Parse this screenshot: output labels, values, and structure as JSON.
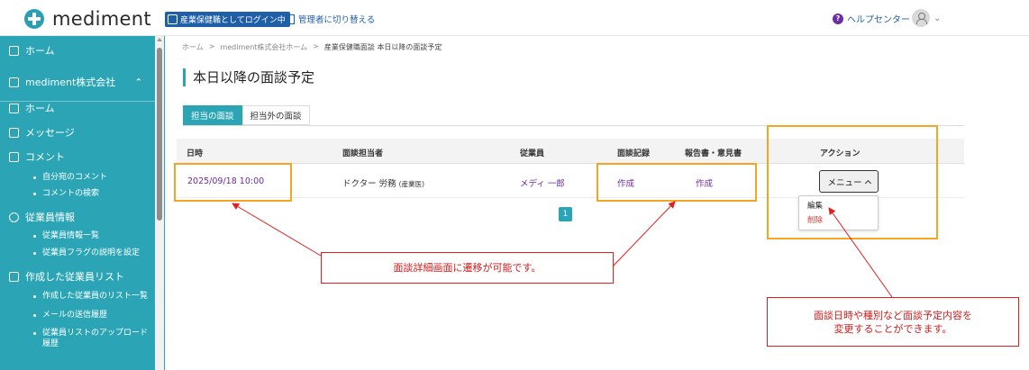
{
  "header": {
    "brand": "mediment",
    "role_badge": "産業保健職としてログイン中",
    "switch_link": "管理者に切り替える",
    "help": "ヘルプセンター"
  },
  "sidebar": {
    "home_top": "ホーム",
    "company": "mediment株式会社",
    "items": [
      {
        "label": "ホーム"
      },
      {
        "label": "メッセージ"
      },
      {
        "label": "コメント"
      },
      {
        "label": "自分宛のコメント"
      },
      {
        "label": "コメントの検索"
      },
      {
        "label": "従業員情報"
      },
      {
        "label": "従業員情報一覧"
      },
      {
        "label": "従業員フラグの説明を設定"
      },
      {
        "label": "作成した従業員リスト"
      },
      {
        "label": "作成した従業員のリスト一覧"
      },
      {
        "label": "メールの送信履歴"
      },
      {
        "label": "従業員リストのアップロード"
      },
      {
        "label": "履歴"
      }
    ]
  },
  "breadcrumb": {
    "items": [
      "ホーム",
      "mediment株式会社ホーム",
      "産業保健職面談 本日以降の面談予定"
    ],
    "separator": ">"
  },
  "page": {
    "title": "本日以降の面談予定",
    "tabs": [
      {
        "label": "担当の面談",
        "active": true
      },
      {
        "label": "担当外の面談",
        "active": false
      }
    ]
  },
  "table": {
    "columns": [
      "日時",
      "面談担当者",
      "従業員",
      "面談記録",
      "報告書・意見書",
      "アクション"
    ],
    "rows": [
      {
        "datetime": "2025/09/18 10:00",
        "interviewer": "ドクター 労務",
        "interviewer_role": "(産業医)",
        "employee": "メディ 一郎",
        "record": "作成",
        "report": "作成",
        "action_label": "メニュー"
      }
    ],
    "dropdown": {
      "edit": "編集",
      "delete": "削除"
    },
    "page_number": "1"
  },
  "annotations": {
    "detail_note": "面談詳細画面に遷移が可能です。",
    "edit_note_line1": "面談日時や種別など面談予定内容を",
    "edit_note_line2": "変更することができます。"
  },
  "colors": {
    "teal": "#2ba5b5",
    "link_purple": "#6a2aa3",
    "highlight_orange": "#f5a524",
    "annotation_red": "#e02020"
  }
}
